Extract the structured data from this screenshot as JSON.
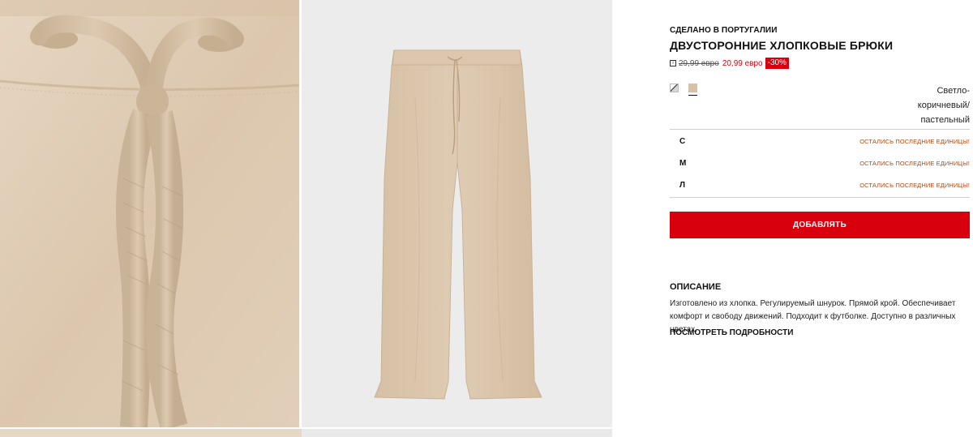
{
  "gallery": {
    "detail_image": "Крупный план пояса брюк со шнурком",
    "full_image": "Двусторонние хлопковые брюки, вид спереди"
  },
  "product": {
    "origin": "СДЕЛАНО В ПОРТУГАЛИИ",
    "title": "ДВУСТОРОННИЕ ХЛОПКОВЫЕ БРЮКИ",
    "info_icon": "i",
    "old_price": "29,99 евро",
    "new_price": "20,99 евро",
    "discount": "-30%"
  },
  "colors": {
    "swatches": [
      {
        "name": "pattern-swatch",
        "color": "#cfcfcf"
      },
      {
        "name": "beige-swatch",
        "color": "#d9bfa4",
        "selected": true
      }
    ],
    "selected_name": "Светло-коричневый/пастельный"
  },
  "sizes": [
    {
      "label": "С",
      "status": "ОСТАЛИСЬ ПОСЛЕДНИЕ ЕДИНИЦЫ!"
    },
    {
      "label": "М",
      "status": "ОСТАЛИСЬ ПОСЛЕДНИЕ ЕДИНИЦЫ!"
    },
    {
      "label": "Л",
      "status": "ОСТАЛИСЬ ПОСЛЕДНИЕ ЕДИНИЦЫ!"
    }
  ],
  "actions": {
    "add_label": "ДОБАВЛЯТЬ"
  },
  "description": {
    "title": "ОПИСАНИЕ",
    "text": "Изготовлено из хлопка. Регулируемый шнурок. Прямой крой. Обеспечивает комфорт и свободу движений. Подходит к футболке. Доступно в различных цветах.",
    "details_link": "ПОСМОТРЕТЬ ПОДРОБНОСТИ"
  },
  "colors_theme": {
    "accent": "#d9000d",
    "warning_text": "#b54a16",
    "fabric": "#d9c1a6"
  }
}
